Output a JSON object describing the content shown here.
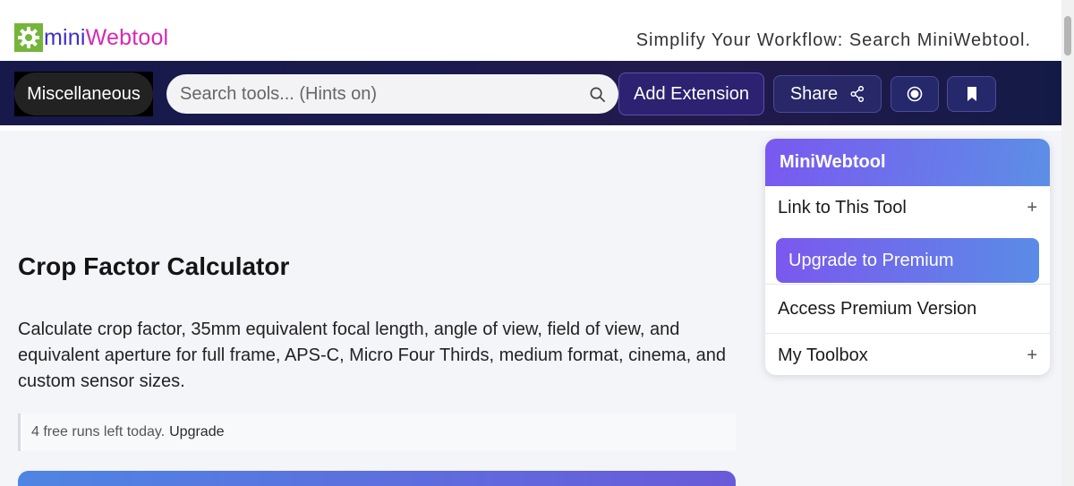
{
  "header": {
    "logo_mini": "mini",
    "logo_web": "Webtool",
    "tagline": "Simplify Your Workflow: Search MiniWebtool."
  },
  "nav": {
    "category": "Miscellaneous",
    "search_placeholder": "Search tools... (Hints on)",
    "add_extension": "Add Extension",
    "share": "Share"
  },
  "main": {
    "title": "Crop Factor Calculator",
    "description": "Calculate crop factor, 35mm equivalent focal length, angle of view, field of view, and equivalent aperture for full frame, APS-C, Micro Four Thirds, medium format, cinema, and custom sensor sizes.",
    "runs_text": "4 free runs left today.",
    "runs_upgrade": "Upgrade"
  },
  "sidebar": {
    "title": "MiniWebtool",
    "link_to_tool": "Link to This Tool",
    "upgrade_premium": "Upgrade to Premium",
    "access_premium": "Access Premium Version",
    "my_toolbox": "My Toolbox",
    "plus": "+"
  },
  "icons": {
    "logo": "gear-icon",
    "search": "search-icon",
    "share": "share-icon",
    "record": "record-icon",
    "bookmark": "bookmark-icon"
  },
  "colors": {
    "nav_bg": "#1b1a4d",
    "logo_green": "#74b63a",
    "logo_mini": "#3d2fc9",
    "logo_web": "#d62ab2",
    "accent_purple": "#7b58ee",
    "accent_blue": "#5a8ce6"
  }
}
